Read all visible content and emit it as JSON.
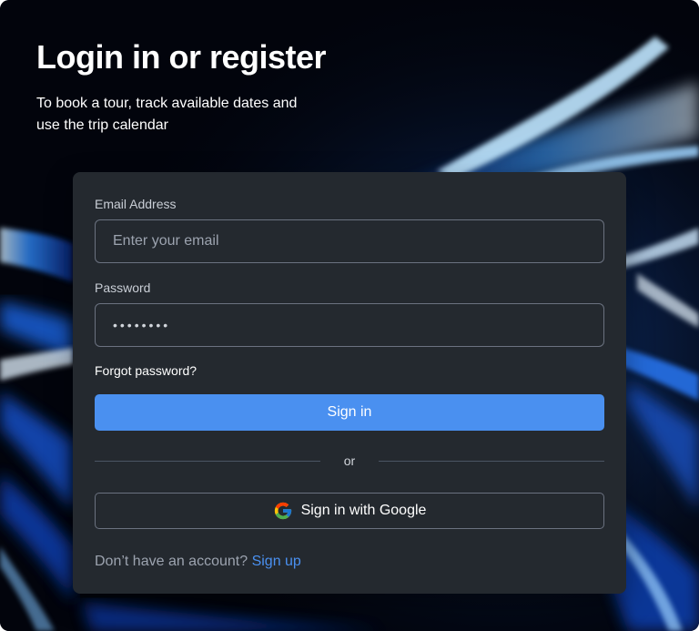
{
  "hero": {
    "title": "Login in or register",
    "subtitle": "To book a tour, track available dates and use the trip calendar"
  },
  "form": {
    "email_label": "Email Address",
    "email_placeholder": "Enter your email",
    "email_value": "",
    "password_label": "Password",
    "password_value": "••••••••",
    "forgot_password": "Forgot password?",
    "sign_in_label": "Sign in",
    "divider_text": "or",
    "google_label": "Sign in with Google",
    "signup_prompt": "Don’t have an account?",
    "signup_link": "Sign up"
  },
  "icons": {
    "google": "google-logo-icon"
  },
  "colors": {
    "accent": "#4a90f0",
    "card_background": "#24292f",
    "page_background": "#02040c"
  }
}
